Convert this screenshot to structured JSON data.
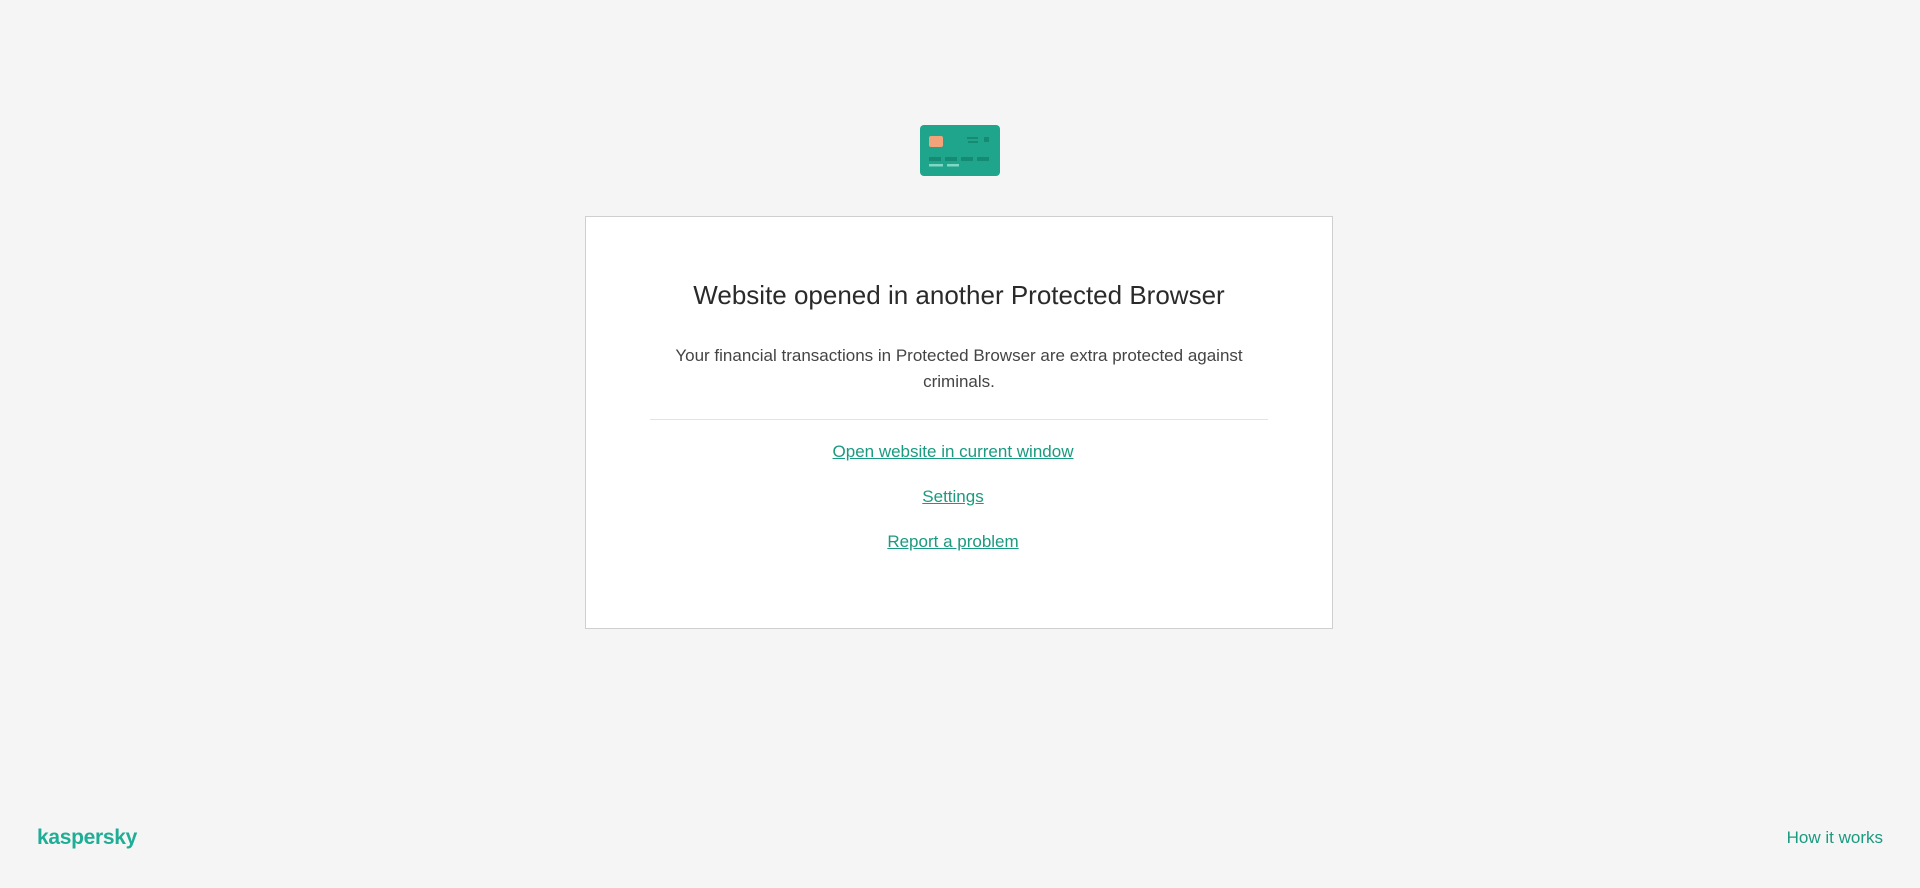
{
  "icon": {
    "name": "credit-card-icon",
    "colors": {
      "card": "#1fa58c",
      "chip": "#f3a37a",
      "marks": "#178a74",
      "light_marks": "#7fd8c5"
    }
  },
  "dialog": {
    "title": "Website opened in another Protected Browser",
    "description": "Your financial transactions in Protected Browser are extra protected against criminals.",
    "links": {
      "open_current": "Open website in current window",
      "settings": "Settings",
      "report": "Report a problem"
    }
  },
  "footer": {
    "brand": "kaspersky",
    "how_it_works": "How it works"
  },
  "colors": {
    "accent": "#1a9a80",
    "background": "#f5f5f5",
    "panel": "#ffffff"
  }
}
